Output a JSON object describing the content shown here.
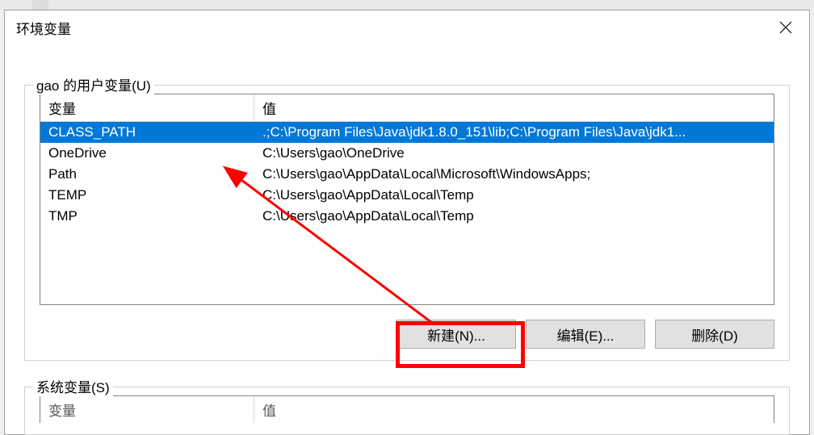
{
  "dialog": {
    "title": "环境变量"
  },
  "userVars": {
    "groupLabel": "gao 的用户变量(U)",
    "headers": {
      "var": "变量",
      "val": "值"
    },
    "rows": [
      {
        "var": "CLASS_PATH",
        "val": ".;C:\\Program Files\\Java\\jdk1.8.0_151\\lib;C:\\Program Files\\Java\\jdk1...",
        "selected": true
      },
      {
        "var": "OneDrive",
        "val": "C:\\Users\\gao\\OneDrive",
        "selected": false
      },
      {
        "var": "Path",
        "val": "C:\\Users\\gao\\AppData\\Local\\Microsoft\\WindowsApps;",
        "selected": false
      },
      {
        "var": "TEMP",
        "val": "C:\\Users\\gao\\AppData\\Local\\Temp",
        "selected": false
      },
      {
        "var": "TMP",
        "val": "C:\\Users\\gao\\AppData\\Local\\Temp",
        "selected": false
      }
    ],
    "buttons": {
      "new": "新建(N)...",
      "edit": "编辑(E)...",
      "delete": "删除(D)"
    }
  },
  "sysVars": {
    "groupLabel": "系统变量(S)",
    "headers": {
      "var": "变量",
      "val": "值"
    }
  }
}
